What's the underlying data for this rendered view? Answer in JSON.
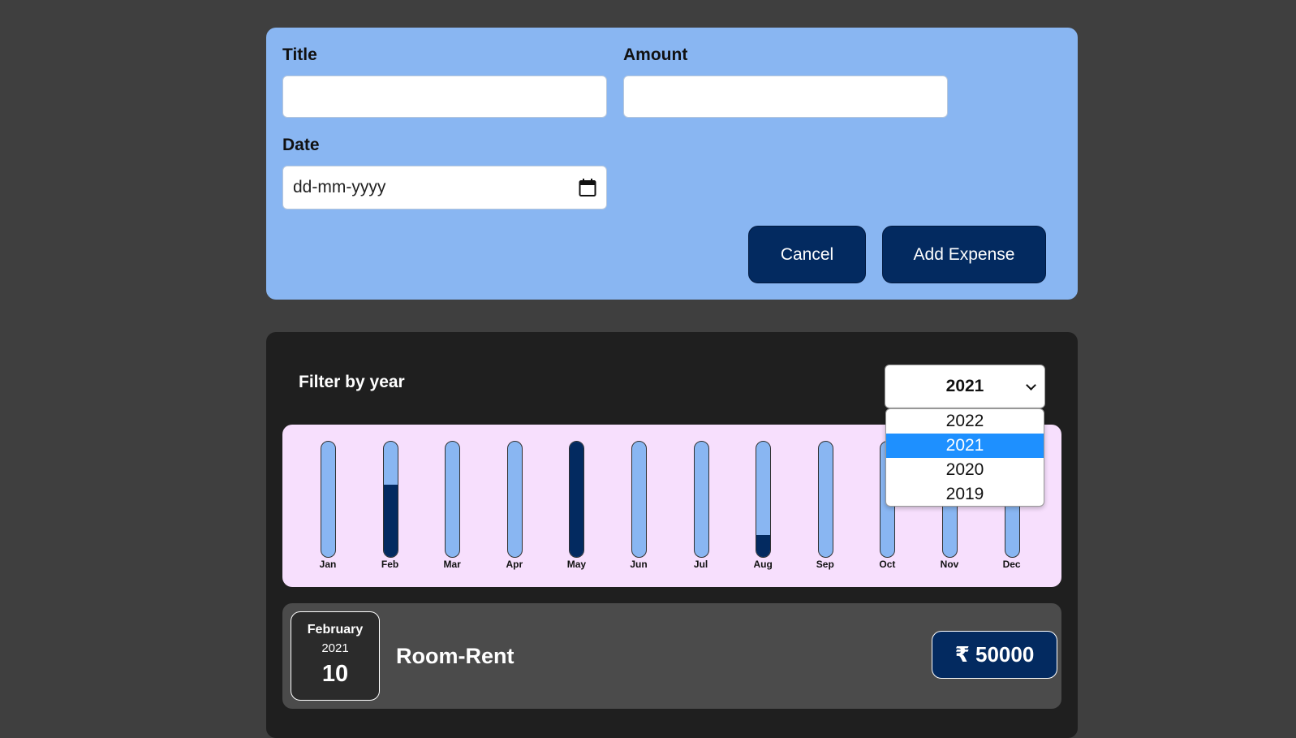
{
  "form": {
    "title_label": "Title",
    "amount_label": "Amount",
    "date_label": "Date",
    "title_value": "",
    "amount_value": "",
    "date_placeholder": "dd-mm-yyyy",
    "cancel_label": "Cancel",
    "submit_label": "Add Expense"
  },
  "filter": {
    "label": "Filter by year",
    "selected": "2021",
    "options": [
      "2022",
      "2021",
      "2020",
      "2019"
    ]
  },
  "chart_data": {
    "type": "bar",
    "categories": [
      "Jan",
      "Feb",
      "Mar",
      "Apr",
      "May",
      "Jun",
      "Jul",
      "Aug",
      "Sep",
      "Oct",
      "Nov",
      "Dec"
    ],
    "values": [
      0,
      0.63,
      0,
      0,
      1.0,
      0,
      0,
      0.19,
      0,
      0,
      0,
      0
    ]
  },
  "expenses": [
    {
      "month": "February",
      "year": "2021",
      "day": "10",
      "title": "Room-Rent",
      "amount": "₹ 50000"
    }
  ],
  "colors": {
    "page_bg": "#3f3f3f",
    "form_bg": "#89b6f2",
    "button_bg": "#032a60",
    "chart_bg": "#f7dffd",
    "bar_track": "#89b6f2",
    "bar_fill": "#032a60",
    "selected_option": "#1e90ff"
  }
}
